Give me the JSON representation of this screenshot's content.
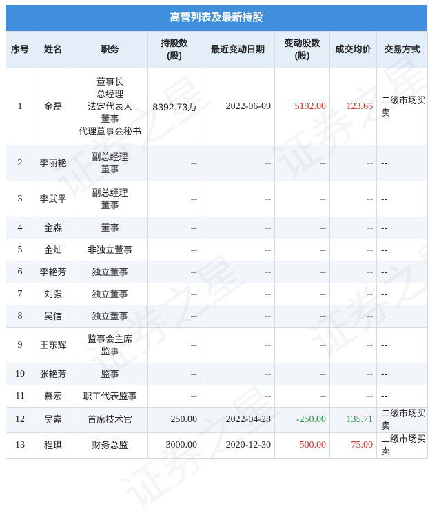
{
  "title": "高管列表及最新持股",
  "headers": {
    "index": "序号",
    "name": "姓名",
    "position": "职务",
    "shares": "持股数\n(股)",
    "date": "最近变动日期",
    "change": "变动股数\n(股)",
    "price": "成交均价",
    "method": "交易方式"
  },
  "watermark": "证券之星",
  "rows": [
    {
      "index": "1",
      "name": "金磊",
      "positions": [
        "董事长",
        "总经理",
        "法定代表人",
        "董事",
        "代理董事会秘书"
      ],
      "shares": "8392.73万",
      "date": "2022-06-09",
      "change": "5192.00",
      "change_color": "red",
      "price": "123.66",
      "price_color": "red",
      "method": "二级市场买卖"
    },
    {
      "index": "2",
      "name": "李丽艳",
      "positions": [
        "副总经理",
        "董事"
      ],
      "shares": "--",
      "date": "--",
      "change": "--",
      "change_color": "",
      "price": "--",
      "price_color": "",
      "method": "--"
    },
    {
      "index": "3",
      "name": "李武平",
      "positions": [
        "副总经理",
        "董事"
      ],
      "shares": "--",
      "date": "--",
      "change": "--",
      "change_color": "",
      "price": "--",
      "price_color": "",
      "method": "--"
    },
    {
      "index": "4",
      "name": "金森",
      "positions": [
        "董事"
      ],
      "shares": "--",
      "date": "--",
      "change": "--",
      "change_color": "",
      "price": "--",
      "price_color": "",
      "method": "--"
    },
    {
      "index": "5",
      "name": "金灿",
      "positions": [
        "非独立董事"
      ],
      "shares": "--",
      "date": "--",
      "change": "--",
      "change_color": "",
      "price": "--",
      "price_color": "",
      "method": "--"
    },
    {
      "index": "6",
      "name": "李艳芳",
      "positions": [
        "独立董事"
      ],
      "shares": "--",
      "date": "--",
      "change": "--",
      "change_color": "",
      "price": "--",
      "price_color": "",
      "method": "--"
    },
    {
      "index": "7",
      "name": "刘强",
      "positions": [
        "独立董事"
      ],
      "shares": "--",
      "date": "--",
      "change": "--",
      "change_color": "",
      "price": "--",
      "price_color": "",
      "method": "--"
    },
    {
      "index": "8",
      "name": "吴信",
      "positions": [
        "独立董事"
      ],
      "shares": "--",
      "date": "--",
      "change": "--",
      "change_color": "",
      "price": "--",
      "price_color": "",
      "method": "--"
    },
    {
      "index": "9",
      "name": "王东辉",
      "positions": [
        "监事会主席",
        "监事"
      ],
      "shares": "--",
      "date": "--",
      "change": "--",
      "change_color": "",
      "price": "--",
      "price_color": "",
      "method": "--"
    },
    {
      "index": "10",
      "name": "张艳芳",
      "positions": [
        "监事"
      ],
      "shares": "--",
      "date": "--",
      "change": "--",
      "change_color": "",
      "price": "--",
      "price_color": "",
      "method": "--"
    },
    {
      "index": "11",
      "name": "慕宏",
      "positions": [
        "职工代表监事"
      ],
      "shares": "--",
      "date": "--",
      "change": "--",
      "change_color": "",
      "price": "--",
      "price_color": "",
      "method": "--"
    },
    {
      "index": "12",
      "name": "吴嘉",
      "positions": [
        "首席技术官"
      ],
      "shares": "250.00",
      "date": "2022-04-28",
      "change": "-250.00",
      "change_color": "green",
      "price": "135.71",
      "price_color": "green",
      "method": "二级市场买卖"
    },
    {
      "index": "13",
      "name": "程琪",
      "positions": [
        "财务总监"
      ],
      "shares": "3000.00",
      "date": "2020-12-30",
      "change": "500.00",
      "change_color": "red",
      "price": "75.00",
      "price_color": "red",
      "method": "二级市场买卖"
    }
  ]
}
